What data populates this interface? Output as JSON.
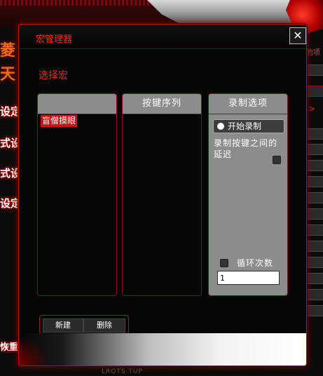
{
  "background_app": {
    "left_chars": [
      "菱",
      "天"
    ],
    "left_menu": [
      "设定",
      "式设",
      "式设定",
      "设定"
    ],
    "left_bottom": "恢重置",
    "right_top_label": "的项",
    "right_arrow": ">",
    "bottom_label": "LROTS TUP"
  },
  "dialog": {
    "title": "宏管理器",
    "close_icon": "✕",
    "section_label": "选择宏",
    "macro_list": {
      "header": "",
      "items": [
        "盲僧摸眼"
      ]
    },
    "key_sequence": {
      "header": "按键序列"
    },
    "record_options": {
      "header": "录制选项",
      "start_record": "开始录制",
      "delay_label": "录制按键之间的延迟",
      "loop_label": "循环次数",
      "loop_count": "1"
    },
    "buttons": {
      "new": "新建",
      "delete": "删除"
    }
  },
  "colors": {
    "accent_red": "#e02a1a",
    "panel_gray": "#8c8c8c",
    "selection_red": "#c41414"
  }
}
